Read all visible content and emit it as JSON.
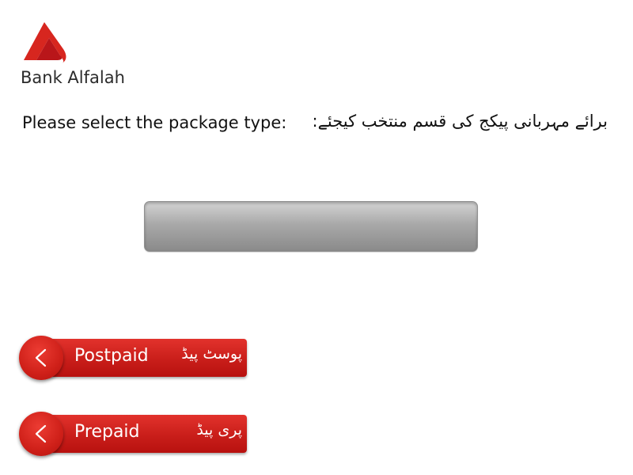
{
  "brand": {
    "name": "Bank Alfalah",
    "logo_icon": "bank-alfalah-logo-icon",
    "accent_color": "#d7261f"
  },
  "prompt": {
    "english": "Please select the package type:",
    "urdu": "برائے مہربانی پیکج کی قسم منتخب کیجئے:"
  },
  "display": {
    "value": ""
  },
  "options": [
    {
      "label_en": "Postpaid",
      "label_ur": "پوسٹ پیڈ",
      "icon": "chevron-left-icon"
    },
    {
      "label_en": "Prepaid",
      "label_ur": "پری پیڈ",
      "icon": "chevron-left-icon"
    }
  ]
}
